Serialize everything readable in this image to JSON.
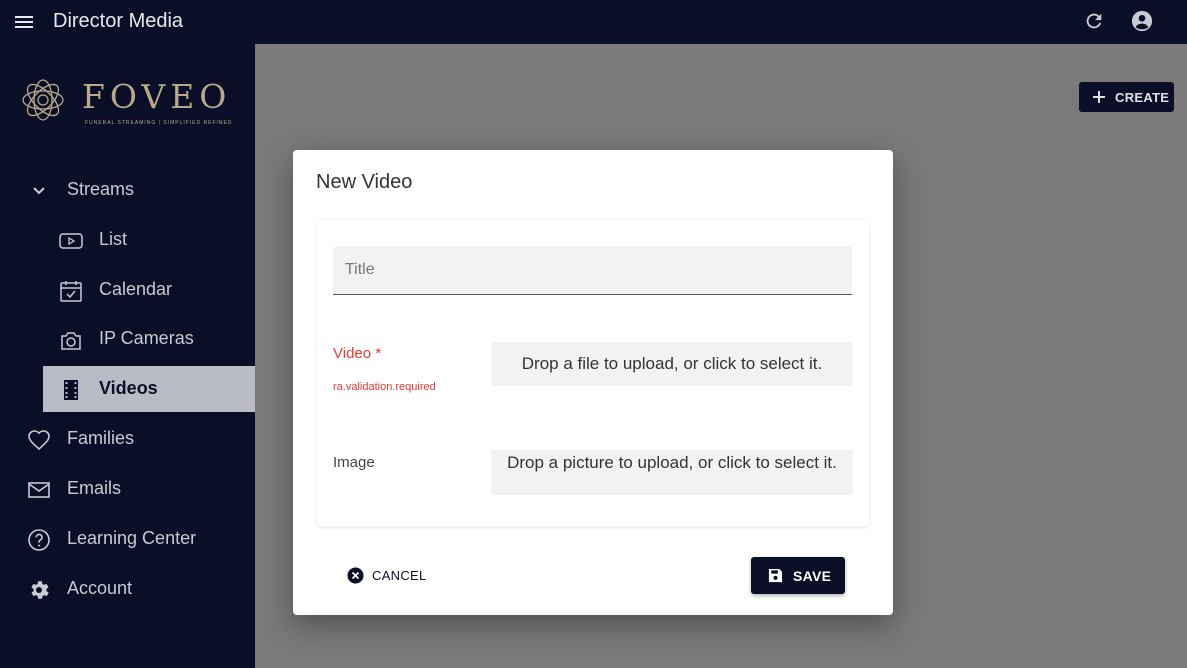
{
  "app": {
    "title": "Director Media"
  },
  "logo": {
    "wordmark": "FOVEO",
    "tagline": "FUNERAL STREAMING | SIMPLIFIED REFINED"
  },
  "sidebar": {
    "items": [
      {
        "label": "Streams",
        "icon": "chevron-down-icon"
      },
      {
        "label": "List",
        "icon": "youtube-icon"
      },
      {
        "label": "Calendar",
        "icon": "calendar-check-icon"
      },
      {
        "label": "IP Cameras",
        "icon": "camera-icon"
      },
      {
        "label": "Videos",
        "icon": "film-icon",
        "active": true
      },
      {
        "label": "Families",
        "icon": "heart-icon"
      },
      {
        "label": "Emails",
        "icon": "mail-icon"
      },
      {
        "label": "Learning Center",
        "icon": "help-circle-icon"
      },
      {
        "label": "Account",
        "icon": "gear-icon"
      }
    ]
  },
  "toolbar": {
    "create_label": "CREATE"
  },
  "dialog": {
    "title": "New Video",
    "title_field": {
      "placeholder": "Title",
      "value": ""
    },
    "video": {
      "label": "Video *",
      "error": "ra.validation.required",
      "dropzone": "Drop a file to upload, or click to select it."
    },
    "image": {
      "label": "Image",
      "dropzone": "Drop a picture to upload, or click to select it."
    },
    "cancel_label": "CANCEL",
    "save_label": "SAVE"
  },
  "colors": {
    "primary": "#0a0e26",
    "error": "#e53935",
    "active_bg": "#b9bcc4",
    "logo_gold": "#b7a98a"
  }
}
